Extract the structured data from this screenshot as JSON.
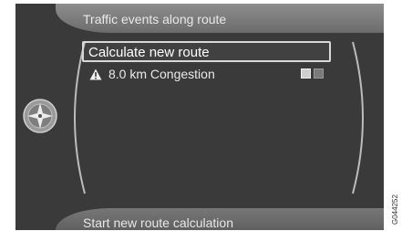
{
  "header": {
    "title": "Traffic events along route"
  },
  "list": {
    "items": [
      {
        "label": "Calculate new route",
        "selected": true
      },
      {
        "label": "8.0 km Congestion",
        "icon": "warning-triangle-icon"
      }
    ]
  },
  "footer": {
    "text": "Start new route calculation"
  },
  "side_code": "G044252",
  "colors": {
    "background": "#3a3a3a",
    "header_band": "#7d7d7d",
    "text": "#ffffff",
    "selection_border": "#d8d8d8"
  }
}
